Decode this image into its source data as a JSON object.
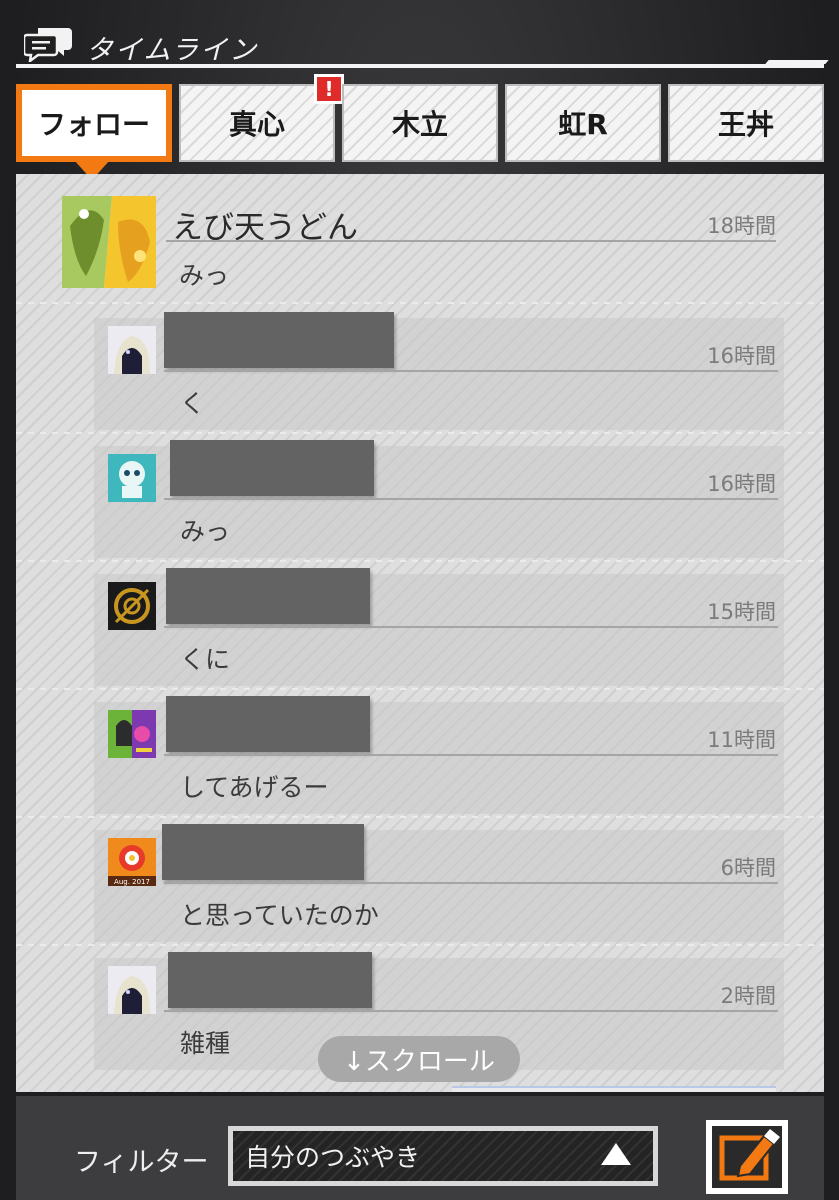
{
  "header": {
    "title": "タイムライン",
    "icon": "chat-bubbles-icon"
  },
  "tabs": [
    {
      "label": "フォロー",
      "active": true
    },
    {
      "label": "真心",
      "active": false,
      "alert": "!"
    },
    {
      "label": "木立",
      "active": false
    },
    {
      "label": "虹R",
      "active": false
    },
    {
      "label": "王丼",
      "active": false
    }
  ],
  "timeline": {
    "main_post": {
      "name": "えび天うどん",
      "time": "18時間",
      "message": "みっ"
    },
    "replies": [
      {
        "time": "16時間",
        "message": "く"
      },
      {
        "time": "16時間",
        "message": "みっ"
      },
      {
        "time": "15時間",
        "message": "くに"
      },
      {
        "time": "11時間",
        "message": "してあげるー"
      },
      {
        "time": "6時間",
        "message": "と思っていたのか",
        "avatar_text": "Aug. 2017"
      },
      {
        "time": "2時間",
        "message": "雑種"
      }
    ],
    "scroll_hint": "↓スクロール"
  },
  "footer": {
    "filter_label": "フィルター",
    "filter_value": "自分のつぶやき",
    "edit_icon": "pencil-square-icon"
  },
  "colors": {
    "accent": "#f37a12",
    "alert": "#e02b2b"
  }
}
